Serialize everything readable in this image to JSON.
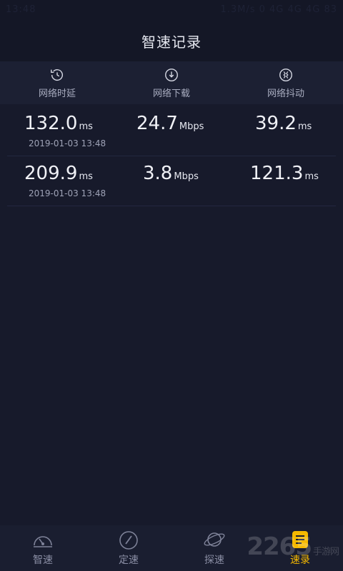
{
  "status": {
    "time": "13:48",
    "right": "1.3M/s 0 4G 4G 4G 83"
  },
  "header": {
    "title": "智速记录"
  },
  "columns": [
    {
      "label": "网络时延",
      "icon": "latency-clock-icon"
    },
    {
      "label": "网络下载",
      "icon": "download-arrow-icon"
    },
    {
      "label": "网络抖动",
      "icon": "jitter-icon"
    }
  ],
  "records": [
    {
      "latency": {
        "value": "132.0",
        "unit": "ms"
      },
      "download": {
        "value": "24.7",
        "unit": "Mbps"
      },
      "jitter": {
        "value": "39.2",
        "unit": "ms"
      },
      "timestamp": "2019-01-03 13:48"
    },
    {
      "latency": {
        "value": "209.9",
        "unit": "ms"
      },
      "download": {
        "value": "3.8",
        "unit": "Mbps"
      },
      "jitter": {
        "value": "121.3",
        "unit": "ms"
      },
      "timestamp": "2019-01-03 13:48"
    }
  ],
  "tabs": [
    {
      "label": "智速",
      "icon": "speedometer-icon"
    },
    {
      "label": "定速",
      "icon": "gauge-needle-icon"
    },
    {
      "label": "探速",
      "icon": "planet-icon"
    },
    {
      "label": "速录",
      "icon": "records-icon",
      "active": true
    }
  ],
  "watermark": {
    "text": "2265",
    "sub": "手游网"
  },
  "colors": {
    "background": "#171a2b",
    "accent": "#f5b900",
    "header": "#1c2033"
  }
}
